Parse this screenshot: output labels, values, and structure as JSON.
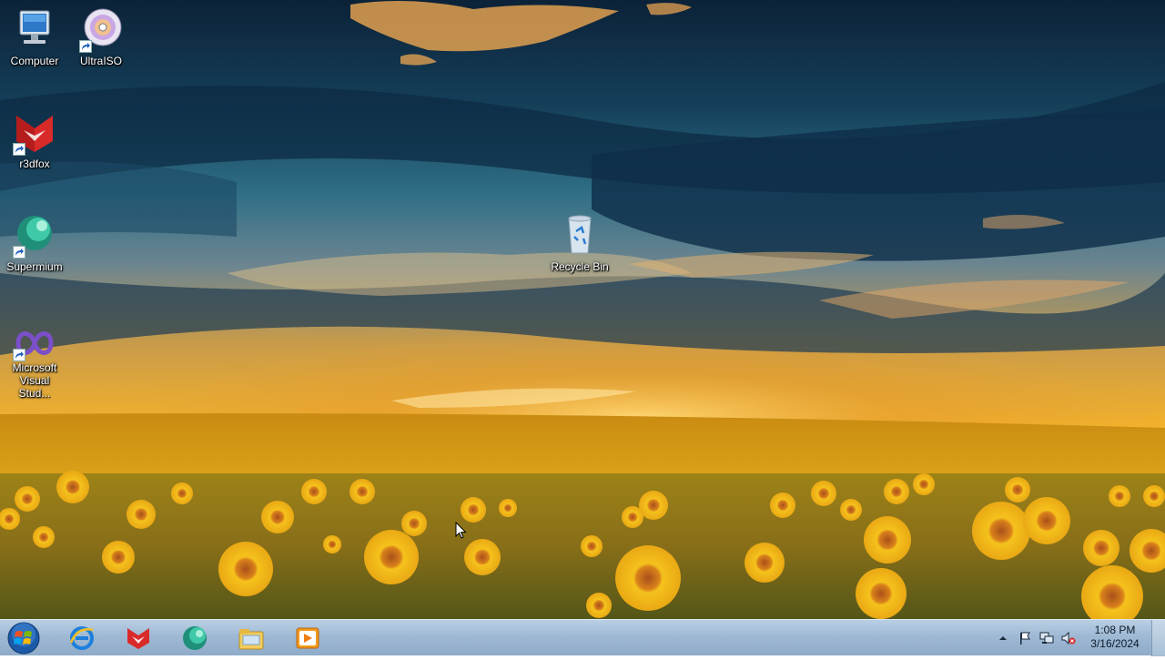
{
  "desktop": {
    "icons": [
      {
        "label": "Computer",
        "icon": "computer-icon"
      },
      {
        "label": "UltraISO",
        "icon": "ultraiso-icon"
      },
      {
        "label": "r3dfox",
        "icon": "r3dfox-icon"
      },
      {
        "label": "Supermium",
        "icon": "supermium-icon"
      },
      {
        "label": "Microsoft Visual Stud...",
        "icon": "visual-studio-icon"
      },
      {
        "label": "Recycle Bin",
        "icon": "recycle-bin-icon"
      }
    ]
  },
  "taskbar": {
    "start": {
      "icon": "windows-start-icon"
    },
    "pinned": [
      {
        "icon": "internet-explorer-icon"
      },
      {
        "icon": "r3dfox-icon"
      },
      {
        "icon": "supermium-icon"
      },
      {
        "icon": "file-explorer-icon"
      },
      {
        "icon": "media-player-icon"
      }
    ],
    "tray": {
      "icons": [
        "show-hidden-icons-arrow",
        "action-center-flag-icon",
        "network-icon",
        "volume-muted-icon"
      ],
      "time": "1:08 PM",
      "date": "3/16/2024"
    }
  },
  "colors": {
    "taskbar": "#9fb9d4",
    "sky_dark": "#0f2a44",
    "sunset": "#f3b22c",
    "field": "#d89a13"
  }
}
